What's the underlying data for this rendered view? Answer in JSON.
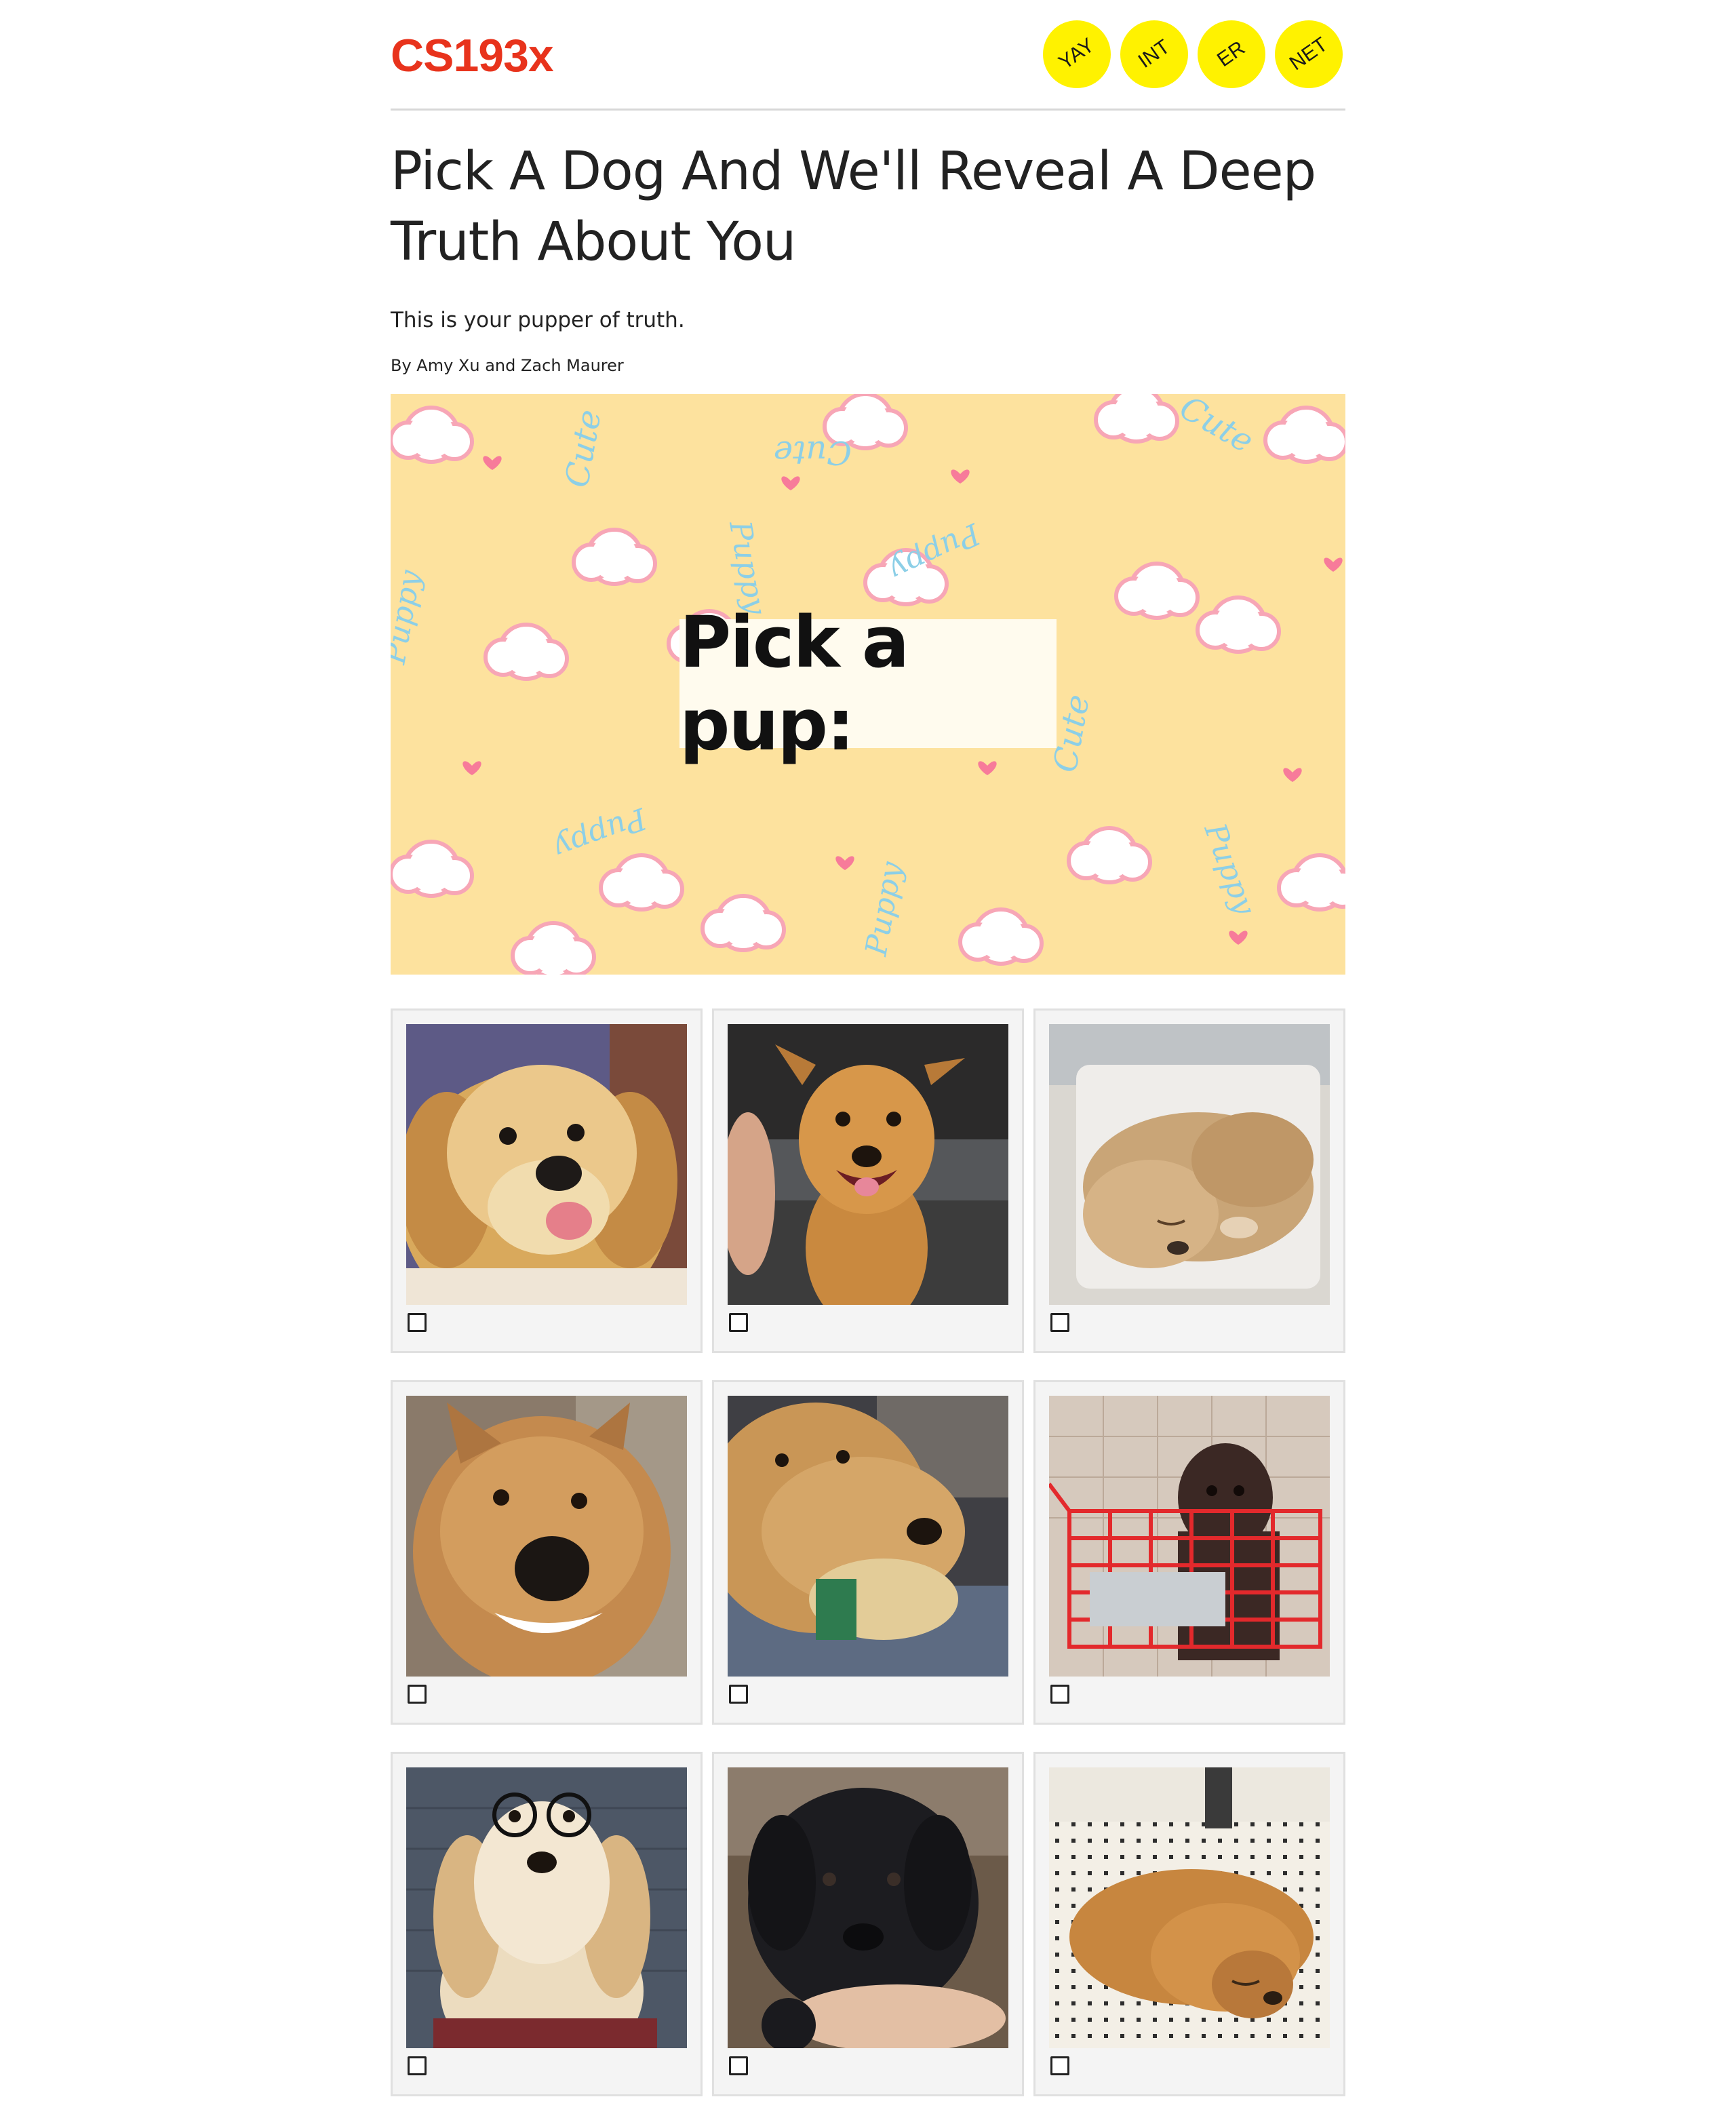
{
  "header": {
    "logo": "CS193x",
    "nav": [
      "YAY",
      "INT",
      "ER",
      "NET"
    ]
  },
  "article": {
    "title": "Pick A Dog And We'll Reveal A Deep Truth About You",
    "subtitle": "This is your pupper of truth.",
    "byline": "By Amy Xu and Zach Maurer"
  },
  "hero": {
    "label": "Pick a pup:",
    "pattern_words": [
      "Cute",
      "Puppy"
    ],
    "colors": {
      "background": "#fde29e",
      "heart": "#f77b9a",
      "text": "#8ccfe7",
      "cloud_outline": "#f7a6b6"
    }
  },
  "quiz": {
    "choices": [
      {
        "subject": "golden-puppy-tongue",
        "checked": false
      },
      {
        "subject": "smiling-tan-dog",
        "checked": false
      },
      {
        "subject": "sleeping-golden-puppy",
        "checked": false
      },
      {
        "subject": "grinning-golden-dog",
        "checked": false
      },
      {
        "subject": "golden-with-toy",
        "checked": false
      },
      {
        "subject": "puppy-in-shopping-cart",
        "checked": false
      },
      {
        "subject": "golden-with-glasses",
        "checked": false
      },
      {
        "subject": "black-lab-puppy",
        "checked": false
      },
      {
        "subject": "golden-lying-on-tiles",
        "checked": false
      }
    ]
  },
  "colors": {
    "logo": "#e8331c",
    "badge": "#fff200",
    "card_background": "#f4f4f4"
  }
}
